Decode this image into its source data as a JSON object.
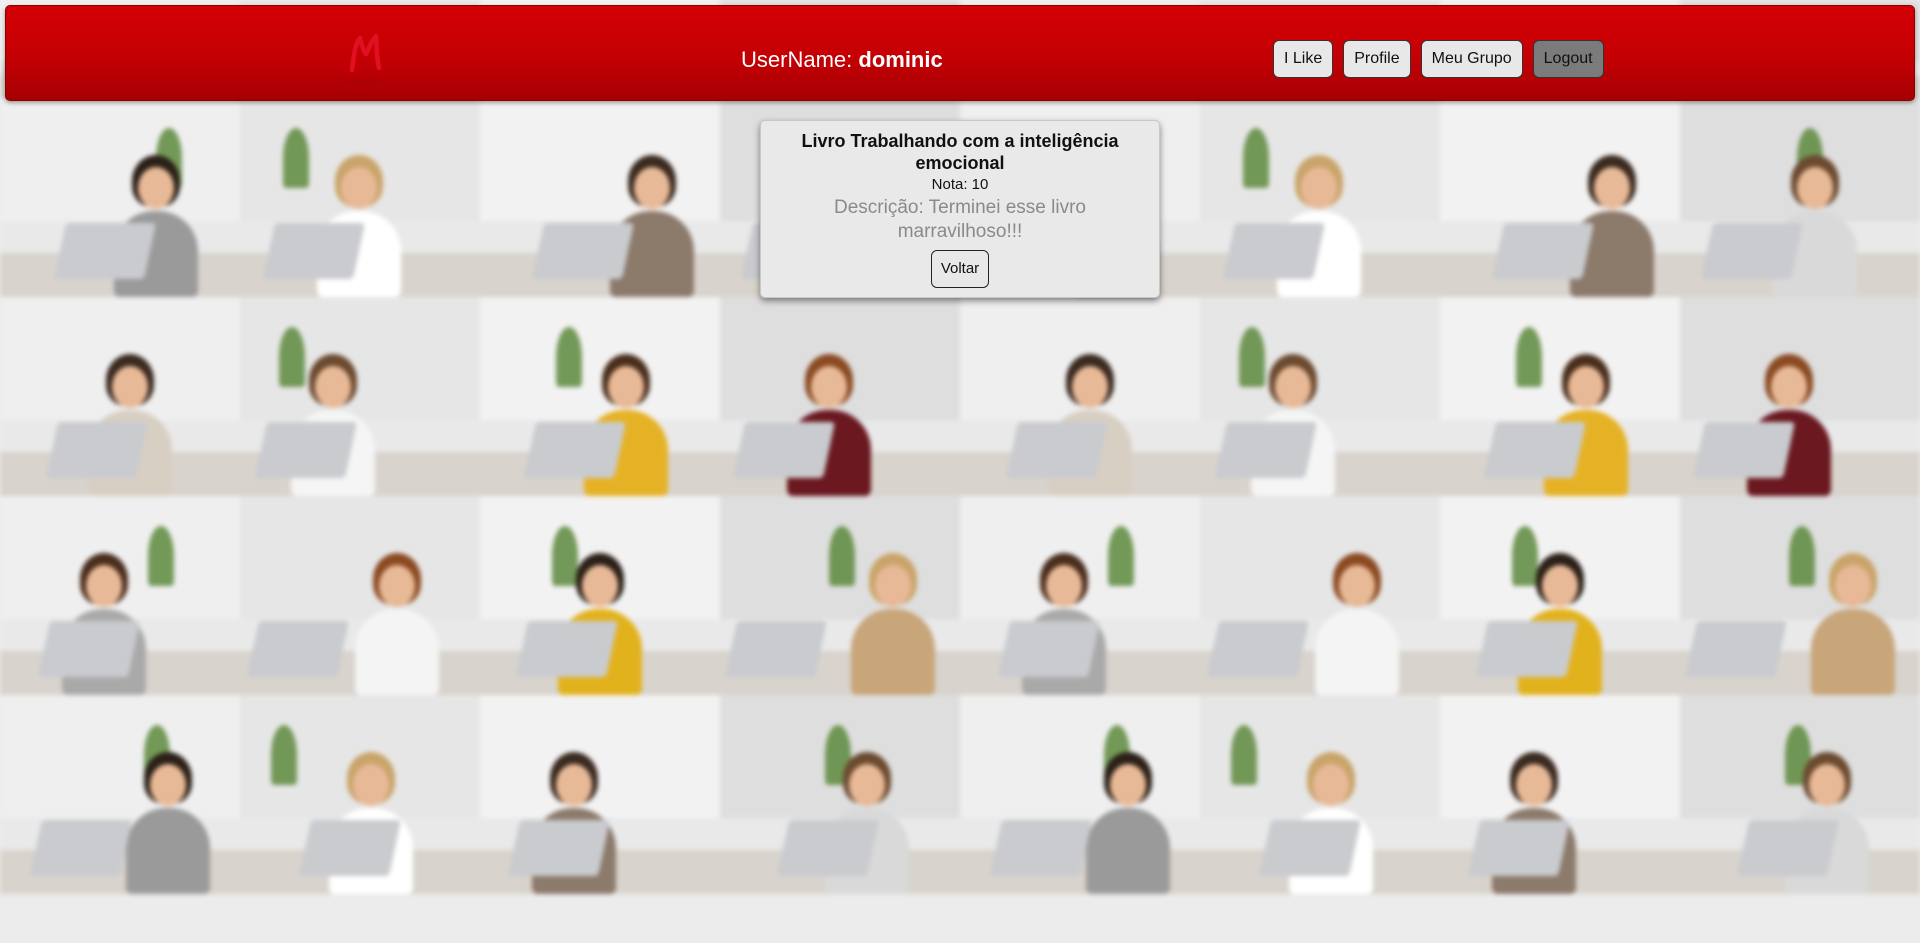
{
  "header": {
    "username_label": "UserName:",
    "username_value": "dominic",
    "nav": {
      "i_like": "I Like",
      "profile": "Profile",
      "meu_grupo": "Meu Grupo",
      "logout": "Logout"
    },
    "brand_color": "#c40004"
  },
  "book": {
    "title": "Livro Trabalhando com a inteligência emocional",
    "nota": "Nota: 10",
    "descricao": "Descrição: Terminei esse livro marravilhoso!!!",
    "back_label": "Voltar"
  },
  "background": {
    "tile_wall_colors": [
      "#efefef",
      "#e6e6e6",
      "#f2f2f2",
      "#dedede",
      "#e9e4df",
      "#f0f0f0",
      "#e3e3e3",
      "#ececec"
    ],
    "tile_shirt_colors": [
      "#a9a9a9",
      "#f4f4f4",
      "#e2b21d",
      "#c9a57a",
      "#d8cfc3",
      "#f5f5f5",
      "#e6b225",
      "#6b1820",
      "#9a9a9a",
      "#ffffff",
      "#8c7a6b",
      "#d9d9d9"
    ],
    "tile_hair_colors": [
      "#4a2e1c",
      "#8a4a22",
      "#2b2018",
      "#c9a46a",
      "#3a2a20",
      "#6b4a30"
    ]
  }
}
